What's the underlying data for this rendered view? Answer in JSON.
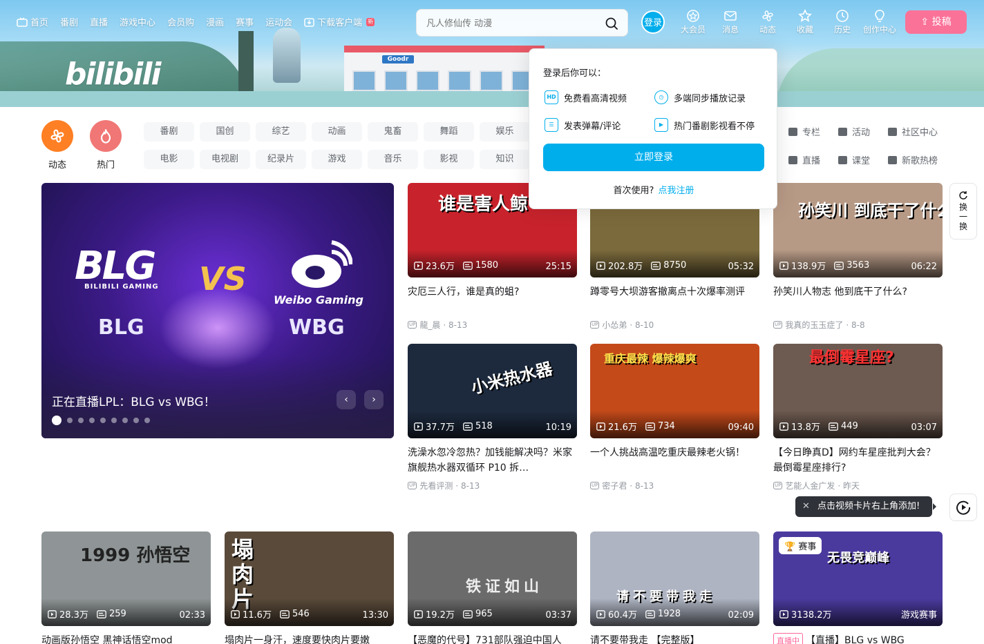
{
  "nav": {
    "left": [
      {
        "label": "首页",
        "icon": "tv-icon"
      },
      {
        "label": "番剧"
      },
      {
        "label": "直播"
      },
      {
        "label": "游戏中心"
      },
      {
        "label": "会员购"
      },
      {
        "label": "漫画"
      },
      {
        "label": "赛事"
      },
      {
        "label": "运动会"
      },
      {
        "label": "下载客户端",
        "icon": "download-icon",
        "badge": "新"
      }
    ],
    "search_placeholder": "凡人修仙传 动漫",
    "login_label": "登录",
    "right": [
      "大会员",
      "消息",
      "动态",
      "收藏",
      "历史",
      "创作中心"
    ],
    "upload_label": "投稿"
  },
  "banner": {
    "logo": "bilibili",
    "store_sign": "Goodr"
  },
  "channels": {
    "big": [
      {
        "label": "动态",
        "color": "#ff7f24"
      },
      {
        "label": "热门",
        "color": "#f07775"
      }
    ],
    "chips": [
      "番剧",
      "国创",
      "综艺",
      "动画",
      "鬼畜",
      "舞蹈",
      "娱乐",
      "电影",
      "电视剧",
      "纪录片",
      "游戏",
      "音乐",
      "影视",
      "知识"
    ],
    "links": [
      "专栏",
      "活动",
      "社区中心",
      "直播",
      "课堂",
      "新歌热榜"
    ]
  },
  "carousel": {
    "caption": "正在直播LPL：BLG vs WBG！",
    "blg_logo": "BLG",
    "blg_sub": "BILIBILI GAMING",
    "vs": "VS",
    "weibo_text": "Weibo Gaming",
    "team_a": "BLG",
    "team_b": "WBG",
    "prev": "‹",
    "next": "›"
  },
  "cards": [
    {
      "views": "23.6万",
      "danmaku": "1580",
      "duration": "25:15",
      "title": "灾厄三人行，谁是真的蛆?",
      "author": "龍_晨",
      "date": "8-13",
      "overlay": "谁是害人鲸",
      "bg": "#c8232c"
    },
    {
      "views": "202.8万",
      "danmaku": "8750",
      "duration": "05:32",
      "title": "蹲零号大坝游客撤离点十次爆率测评",
      "author": "小怂弟",
      "date": "8-10",
      "overlay": "",
      "bg": "#7b6a3c"
    },
    {
      "views": "138.9万",
      "danmaku": "3563",
      "duration": "06:22",
      "title": "孙笑川人物志 他到底干了什么?",
      "author": "我真的玉玉症了",
      "date": "8-8",
      "overlay": "孙笑川 到底干了什么?",
      "bg": "#b79a86"
    },
    {
      "views": "37.7万",
      "danmaku": "518",
      "duration": "10:19",
      "title": "洗澡水忽冷忽热？加钱能解决吗？米家旗舰热水器双循环 P10 拆…",
      "author": "先看评测",
      "date": "8-13",
      "overlay": "小米热水器",
      "bg": "#1d2a3e"
    },
    {
      "views": "21.6万",
      "danmaku": "734",
      "duration": "09:40",
      "title": "一个人挑战高温吃重庆最辣老火锅！",
      "author": "密子君",
      "date": "8-13",
      "overlay": "重庆最辣 爆辣爆爽",
      "bg": "#c44a1a"
    },
    {
      "views": "13.8万",
      "danmaku": "449",
      "duration": "03:07",
      "title": "【今日睁真D】网约车星座批判大会？最倒霉星座排行?",
      "author": "艺能人金广发",
      "date": "昨天",
      "overlay": "最倒霉星座?",
      "bg": "#6d5a50"
    },
    {
      "views": "28.3万",
      "danmaku": "259",
      "duration": "02:33",
      "title": "动画版孙悟空 黑神话悟空mod",
      "author": "",
      "date": "",
      "overlay": "1999 孙悟空",
      "bg": "#8f9596"
    },
    {
      "views": "11.6万",
      "danmaku": "546",
      "duration": "13:30",
      "title": "塌肉片一身汗，速度要快肉片要嫩",
      "author": "",
      "date": "",
      "overlay": "塌肉片",
      "bg": "#5a4a3a"
    },
    {
      "views": "19.2万",
      "danmaku": "965",
      "duration": "03:37",
      "title": "【恶魔的代号】731部队强迫中国人",
      "author": "",
      "date": "",
      "overlay": "铁证如山",
      "bg": "#6b6b6b"
    },
    {
      "views": "60.4万",
      "danmaku": "1928",
      "duration": "02:09",
      "title": "请不要带我走 【完整版】",
      "author": "",
      "date": "",
      "overlay": "请不要带我走",
      "bg": "#aeb4c2"
    },
    {
      "views": "3138.2万",
      "danmaku": "",
      "duration": "游戏赛事",
      "title": "【直播】BLG vs WBG",
      "author": "",
      "date": "",
      "overlay": "无畏竞巅峰",
      "bg": "#4a3a9e",
      "tag": "赛事",
      "live": "直播中"
    }
  ],
  "refresh_label": [
    "换",
    "一",
    "换"
  ],
  "tip": "点击视频卡片右上角添加!",
  "login_popup": {
    "head": "登录后你可以：",
    "benefits": [
      "免费看高清视频",
      "多端同步播放记录",
      "发表弹幕/评论",
      "热门番剧影视看不停"
    ],
    "button": "立即登录",
    "register_prefix": "首次使用?",
    "register_link": "点我注册"
  }
}
